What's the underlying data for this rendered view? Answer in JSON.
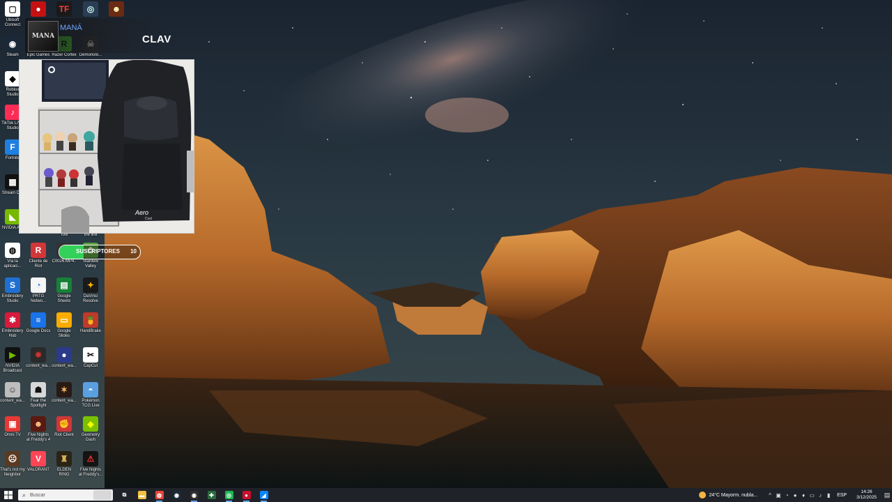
{
  "desktop_icons": [
    {
      "id": "ubisoft",
      "label": "Ubisoft Connect",
      "color": "#ffffff",
      "fg": "#222",
      "glyph": "▢",
      "icon": "file-icon"
    },
    {
      "id": "among",
      "label": "",
      "color": "#c51111",
      "fg": "#fff",
      "glyph": "●",
      "icon": "amongus-icon"
    },
    {
      "id": "tf",
      "label": "",
      "color": "#1a1a1a",
      "fg": "#ff3b3b",
      "glyph": "TF",
      "icon": "tf-icon"
    },
    {
      "id": "jedi",
      "label": "",
      "color": "#2a3d55",
      "fg": "#cfe",
      "glyph": "◎",
      "icon": "helmet-icon"
    },
    {
      "id": "fnaf",
      "label": "",
      "color": "#6b2b12",
      "fg": "#ffb",
      "glyph": "☻",
      "icon": "freddy-icon"
    },
    {
      "id": "steam",
      "label": "Steam",
      "color": "#1b2838",
      "fg": "#fff",
      "glyph": "◉",
      "icon": "steam-icon"
    },
    {
      "id": "epic",
      "label": "Epic Games",
      "color": "#2a2a2a",
      "fg": "#fff",
      "glyph": "E",
      "icon": "epic-icon"
    },
    {
      "id": "razer",
      "label": "Razer Cortex",
      "color": "#44d62c",
      "fg": "#000",
      "glyph": "R",
      "icon": "razer-icon"
    },
    {
      "id": "demon",
      "label": "Demonolo...",
      "color": "#2b2b2b",
      "fg": "#ccc",
      "glyph": "☠",
      "icon": "demonologist-icon"
    },
    {
      "id": "roblox",
      "label": "Roblox Studio",
      "color": "#ffffff",
      "fg": "#000",
      "glyph": "◆",
      "icon": "roblox-icon"
    },
    {
      "id": "tiktok",
      "label": "TikTok LIVE Studio",
      "color": "#fe2c55",
      "fg": "#fff",
      "glyph": "♪",
      "icon": "tiktok-icon"
    },
    {
      "id": "fortnite",
      "label": "Fortnite",
      "color": "#1f7fe0",
      "fg": "#fff",
      "glyph": "F",
      "icon": "fortnite-icon"
    },
    {
      "id": "streamdeck",
      "label": "Stream D...",
      "color": "#111",
      "fg": "#fff",
      "glyph": "▦",
      "icon": "streamdeck-icon"
    },
    {
      "id": "nvidia",
      "label": "NVIDIA A...",
      "color": "#76b900",
      "fg": "#fff",
      "glyph": "◣",
      "icon": "nvidia-icon"
    },
    {
      "id": "tool",
      "label": "Tool",
      "color": "#333",
      "fg": "#fff",
      "glyph": "⚙",
      "icon": "tool-icon"
    },
    {
      "id": "thelink",
      "label": "the link",
      "color": "#333",
      "fg": "#fff",
      "glyph": "∞",
      "icon": "link-icon"
    },
    {
      "id": "chrome-app",
      "label": "Vía la aplicaci...",
      "color": "#ffffff",
      "fg": "#000",
      "glyph": "◍",
      "icon": "chrome-icon"
    },
    {
      "id": "riot",
      "label": "Cliente de Riot",
      "color": "#d13639",
      "fg": "#fff",
      "glyph": "R",
      "icon": "riot-client-icon"
    },
    {
      "id": "c0026",
      "label": "C0026.MP4...",
      "color": "#333",
      "fg": "#fff",
      "glyph": "▶",
      "icon": "video-file-icon"
    },
    {
      "id": "stardew",
      "label": "Stardew Valley",
      "color": "#5a9f3c",
      "fg": "#fff",
      "glyph": "✿",
      "icon": "stardew-icon"
    },
    {
      "id": "embroidery-studio",
      "label": "Embroidery Studio",
      "color": "#1f6fd1",
      "fg": "#fff",
      "glyph": "S",
      "icon": "embroidery-studio-icon"
    },
    {
      "id": "prtg",
      "label": "PRTG Netwo...",
      "color": "#f5f5f5",
      "fg": "#1a73e8",
      "glyph": "◔",
      "icon": "prtg-icon"
    },
    {
      "id": "sheets",
      "label": "Google Sheets",
      "color": "#188038",
      "fg": "#fff",
      "glyph": "▤",
      "icon": "google-sheets-icon"
    },
    {
      "id": "davinci",
      "label": "DaVinci Resolve",
      "color": "#1a1a1a",
      "fg": "#ffb300",
      "glyph": "✦",
      "icon": "davinci-icon"
    },
    {
      "id": "embroidery-hub",
      "label": "Embroidery Hub",
      "color": "#d81b3c",
      "fg": "#fff",
      "glyph": "✱",
      "icon": "embroidery-hub-icon"
    },
    {
      "id": "docs",
      "label": "Google Docs",
      "color": "#1a73e8",
      "fg": "#fff",
      "glyph": "≡",
      "icon": "google-docs-icon"
    },
    {
      "id": "slides",
      "label": "Google Slides",
      "color": "#f9ab00",
      "fg": "#fff",
      "glyph": "▭",
      "icon": "google-slides-icon"
    },
    {
      "id": "handbrake",
      "label": "HandBrake",
      "color": "#c0392b",
      "fg": "#fff",
      "glyph": "🍍",
      "icon": "handbrake-icon"
    },
    {
      "id": "nv-broadcast",
      "label": "NVIDIA Broadcast",
      "color": "#111",
      "fg": "#76b900",
      "glyph": "▶",
      "icon": "nvidia-broadcast-icon"
    },
    {
      "id": "cw1",
      "label": "content_wa...",
      "color": "#2a2a2a",
      "fg": "#c33",
      "glyph": "✸",
      "icon": "content-warning-icon"
    },
    {
      "id": "cw2",
      "label": "content_wa...",
      "color": "#2c3a8a",
      "fg": "#fff",
      "glyph": "●",
      "icon": "content-warning-icon"
    },
    {
      "id": "capcut",
      "label": "CapCut",
      "color": "#ffffff",
      "fg": "#000",
      "glyph": "✂",
      "icon": "capcut-icon"
    },
    {
      "id": "cw3",
      "label": "content_wa...",
      "color": "#bdbdbd",
      "fg": "#333",
      "glyph": "☺",
      "icon": "content-warning-icon"
    },
    {
      "id": "fear",
      "label": "Fear the Spotlight",
      "color": "#d8d8d8",
      "fg": "#111",
      "glyph": "☗",
      "icon": "fear-the-spotlight-icon"
    },
    {
      "id": "cw4",
      "label": "content_wa...",
      "color": "#2a1a14",
      "fg": "#fb6",
      "glyph": "✶",
      "icon": "content-warning-icon"
    },
    {
      "id": "pokemon",
      "label": "Pokémon TCG Live",
      "color": "#5aa0e0",
      "fg": "#fff",
      "glyph": "◓",
      "icon": "pokemon-icon"
    },
    {
      "id": "omni",
      "label": "Omni TV",
      "color": "#e53935",
      "fg": "#fff",
      "glyph": "▣",
      "icon": "omni-tv-icon"
    },
    {
      "id": "fnaf4",
      "label": "Five Nights at Freddy's 4",
      "color": "#5a1a12",
      "fg": "#fc8",
      "glyph": "☻",
      "icon": "fnaf4-icon"
    },
    {
      "id": "riot2",
      "label": "Riot Client",
      "color": "#d13639",
      "fg": "#fff",
      "glyph": "✊",
      "icon": "riot-client-icon"
    },
    {
      "id": "gd",
      "label": "Geometry Dash",
      "color": "#79c000",
      "fg": "#ff0",
      "glyph": "◈",
      "icon": "geometry-dash-icon"
    },
    {
      "id": "neighbor",
      "label": "That's not my Neighbor",
      "color": "#5b3a22",
      "fg": "#fff",
      "glyph": "☹",
      "icon": "neighbor-icon"
    },
    {
      "id": "valorant",
      "label": "VALORANT",
      "color": "#fd4556",
      "fg": "#fff",
      "glyph": "V",
      "icon": "valorant-icon"
    },
    {
      "id": "elden",
      "label": "ELDEN RING",
      "color": "#2b2416",
      "fg": "#d9b35c",
      "glyph": "♜",
      "icon": "elden-ring-icon"
    },
    {
      "id": "fnaf2",
      "label": "Five Nights at Freddy's...",
      "color": "#141414",
      "fg": "#e33",
      "glyph": "⚠",
      "icon": "fnaf-icon"
    }
  ],
  "now_playing": {
    "artist": "MANÁ",
    "title": "CLAV",
    "cover_text": "MANA"
  },
  "subscribers": {
    "label": "SUSCRIPTORES",
    "count": "10",
    "progress": 0.3,
    "fill_color": "#34d15a"
  },
  "taskbar": {
    "search_placeholder": "Buscar",
    "apps": [
      {
        "name": "task-view",
        "glyph": "⧉",
        "color": "transparent",
        "active": false
      },
      {
        "name": "file-explorer",
        "glyph": "▬",
        "color": "#f0c040",
        "active": false
      },
      {
        "name": "chrome",
        "glyph": "◍",
        "color": "#e8453c",
        "active": true
      },
      {
        "name": "steam",
        "glyph": "◉",
        "color": "#1b2838",
        "active": false
      },
      {
        "name": "obs",
        "glyph": "◉",
        "color": "#302e31",
        "active": true
      },
      {
        "name": "gamepad",
        "glyph": "✚",
        "color": "#2b6a3c",
        "active": false
      },
      {
        "name": "spotify",
        "glyph": "◎",
        "color": "#1db954",
        "active": true
      },
      {
        "name": "record",
        "glyph": "●",
        "color": "#c8102e",
        "active": true
      },
      {
        "name": "streamer",
        "glyph": "◢",
        "color": "#0a84ff",
        "active": true
      }
    ],
    "weather_temp": "24°C",
    "weather_desc": "Mayorm. nubla...",
    "language": "ESP",
    "time": "14:26",
    "date": "3/12/2025"
  },
  "colors": {
    "taskbar_bg": "#1f2329",
    "accent": "#6aa4ff"
  }
}
